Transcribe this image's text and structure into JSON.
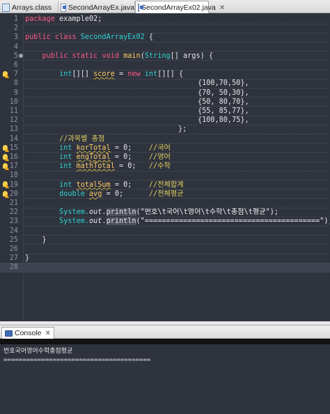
{
  "tabs": [
    {
      "label": "Arrays.class",
      "icon": "class-file-icon"
    },
    {
      "label": "SecondArrayEx.java",
      "icon": "java-file-icon"
    },
    {
      "label": "SecondArrayEx02.java",
      "icon": "java-file-icon",
      "active": true,
      "close": "✕"
    }
  ],
  "editor": {
    "line_numbers": [
      "1",
      "2",
      "3",
      "4",
      "5",
      "6",
      "7",
      "8",
      "9",
      "10",
      "11",
      "12",
      "13",
      "14",
      "15",
      "16",
      "17",
      "18",
      "19",
      "20",
      "21",
      "22",
      "23",
      "24",
      "25",
      "26",
      "27",
      "28"
    ],
    "lines": {
      "l1": {
        "kw": "package",
        "rest": " example02;"
      },
      "l3": {
        "kw1": "public",
        "kw2": "class",
        "name": "SecondArrayEx02",
        "rest": " {"
      },
      "l5": {
        "kw1": "public",
        "kw2": "static",
        "kw3": "void",
        "method": "main",
        "type": "String",
        "rest1": "(",
        "rest2": "[] args) {"
      },
      "l7": {
        "ty": "int",
        "rest1": "[][] ",
        "var": "score",
        "rest2": " = ",
        "kw": "new",
        "ty2": " int",
        "rest3": "[][] {"
      },
      "l8": "{100,70,50},",
      "l9": "{70, 50,30},",
      "l10": "{50, 80,70},",
      "l11": "{55, 85,77},",
      "l12": "{100,80,75},",
      "l13": "};",
      "l14": "//과목별 총점",
      "l15": {
        "ty": "int",
        "var": "korTotal",
        "rest": " = 0;",
        "cm": "//국어"
      },
      "l16": {
        "ty": "int",
        "var": "engTotal",
        "rest": " = 0;",
        "cm": "//영어"
      },
      "l17": {
        "ty": "int",
        "var": "mathTotal",
        "rest": " = 0;",
        "cm": "//수학"
      },
      "l19": {
        "ty": "int",
        "var": "totalSum",
        "rest": " = 0;",
        "cm": "//전체합계"
      },
      "l20": {
        "ty": "double",
        "var": "avg",
        "rest": " = 0;",
        "cm": "//전체평균"
      },
      "l22": {
        "obj": "System.",
        "fld": "out",
        "dot": ".",
        "mth": "println",
        "str": "(\"번호\\t국어\\t영어\\t수학\\t총점\\t평균\");"
      },
      "l23": {
        "obj": "System.",
        "fld": "out",
        "dot": ".",
        "mth": "println",
        "str": "(\"=========================================\");"
      },
      "l25": "}",
      "l27": "}"
    }
  },
  "console": {
    "tab_label": "Console",
    "close": "✕",
    "output": [
      "번호국어영어수학총점평균",
      "======================================="
    ]
  },
  "colors": {
    "editor_bg": "#2f333d",
    "keyword": "#ff5c8a",
    "type": "#2fd3d3",
    "variable": "#ffcc66",
    "comment": "#e0d060"
  }
}
